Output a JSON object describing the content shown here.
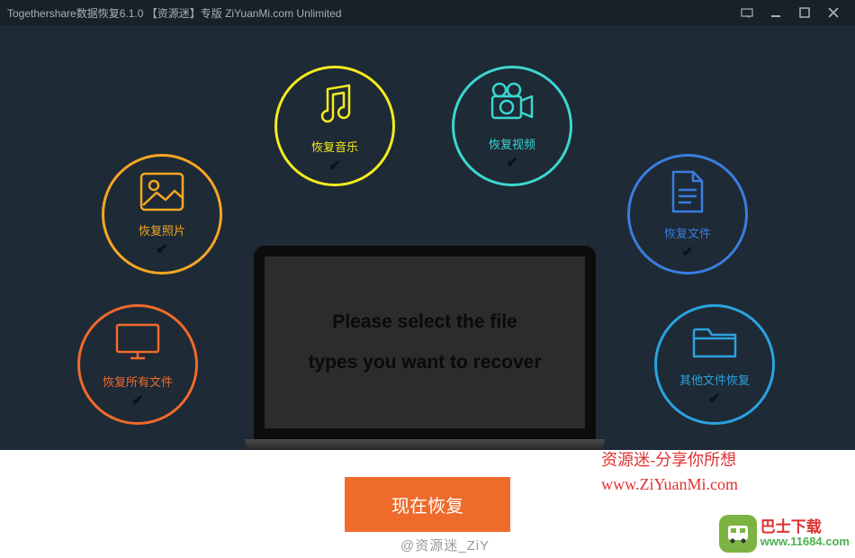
{
  "titlebar": {
    "title": "Togethershare数据恢复6.1.0 【资源迷】专版 ZiYuanMi.com Unlimited"
  },
  "options": {
    "music": {
      "label": "恢复音乐"
    },
    "video": {
      "label": "恢复视频"
    },
    "photo": {
      "label": "恢复照片"
    },
    "doc": {
      "label": "恢复文件"
    },
    "all": {
      "label": "恢复所有文件"
    },
    "other": {
      "label": "其他文件恢复"
    }
  },
  "laptop": {
    "line1": "Please select the file",
    "line2": "types you want to recover"
  },
  "action": {
    "recover": "现在恢复"
  },
  "promo": {
    "line1": "资源迷-分享你所想",
    "line2": "www.ZiYuanMi.com"
  },
  "watermark": "@资源迷_ZiY",
  "badge": {
    "name": "巴士下载",
    "url": "www.11684.com"
  },
  "colors": {
    "music": "#f5eb1e",
    "video": "#3bd6d0",
    "photo": "#f5a623",
    "doc": "#3a7de0",
    "all": "#f06a2c",
    "other": "#2aa3e0",
    "accent": "#ee6b2c"
  }
}
